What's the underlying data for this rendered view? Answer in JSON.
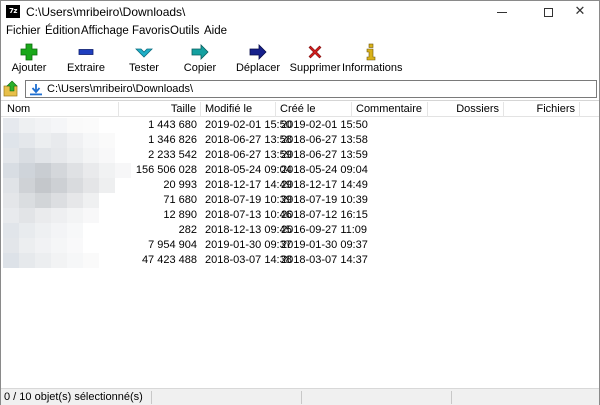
{
  "window": {
    "app_icon_text": "7z",
    "title": "C:\\Users\\mribeiro\\Downloads\\"
  },
  "menu": [
    "Fichier",
    "Édition",
    "Affichage",
    "Favoris",
    "Outils",
    "Aide"
  ],
  "toolbar": [
    {
      "label": "Ajouter",
      "icon": "add-icon",
      "color": "#1aa81a"
    },
    {
      "label": "Extraire",
      "icon": "extract-icon",
      "color": "#1f3fbf"
    },
    {
      "label": "Tester",
      "icon": "test-icon",
      "color": "#1fb0c8"
    },
    {
      "label": "Copier",
      "icon": "copy-icon",
      "color": "#14a0a0"
    },
    {
      "label": "Déplacer",
      "icon": "move-icon",
      "color": "#16208c"
    },
    {
      "label": "Supprimer",
      "icon": "delete-icon",
      "color": "#d41f1f"
    },
    {
      "label": "Informations",
      "icon": "info-icon",
      "color": "#d9b21a"
    }
  ],
  "address": {
    "path": "C:\\Users\\mribeiro\\Downloads\\"
  },
  "columns": [
    "Nom",
    "Taille",
    "Modifié le",
    "Créé le",
    "Commentaire",
    "Dossiers",
    "Fichiers"
  ],
  "files": [
    {
      "size": "1 443 680",
      "modified": "2019-02-01 15:50",
      "created": "2019-02-01 15:50"
    },
    {
      "size": "1 346 826",
      "modified": "2018-06-27 13:58",
      "created": "2018-06-27 13:58"
    },
    {
      "size": "2 233 542",
      "modified": "2018-06-27 13:59",
      "created": "2018-06-27 13:59"
    },
    {
      "size": "156 506 028",
      "modified": "2018-05-24 09:04",
      "created": "2018-05-24 09:04"
    },
    {
      "size": "20 993",
      "modified": "2018-12-17 14:49",
      "created": "2018-12-17 14:49"
    },
    {
      "size": "71 680",
      "modified": "2018-07-19 10:39",
      "created": "2018-07-19 10:39"
    },
    {
      "size": "12 890",
      "modified": "2018-07-13 10:46",
      "created": "2018-07-12 16:15"
    },
    {
      "size": "282",
      "modified": "2018-12-13 09:45",
      "created": "2016-09-27 11:09"
    },
    {
      "size": "7 954 904",
      "modified": "2019-01-30 09:37",
      "created": "2019-01-30 09:37"
    },
    {
      "size": "47 423 488",
      "modified": "2018-03-07 14:38",
      "created": "2018-03-07 14:37"
    }
  ],
  "status": {
    "text": "0 / 10 objet(s) sélectionné(s)"
  }
}
